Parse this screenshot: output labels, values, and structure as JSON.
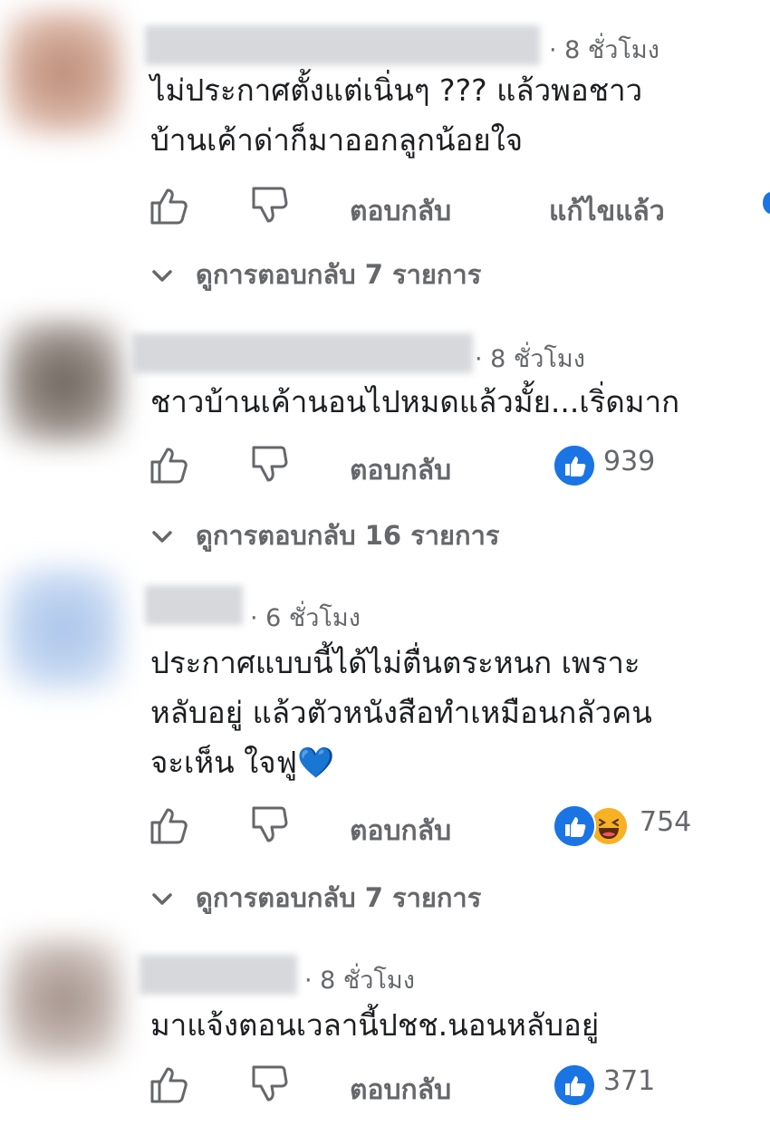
{
  "colors": {
    "accent": "#1b74e4",
    "secondary_text": "#65676b",
    "primary_text": "#1c1e21",
    "haha": "#f7b125"
  },
  "icons": {
    "like": "thumbs-up-outline-icon",
    "dislike": "thumbs-down-outline-icon",
    "expand": "chevron-down-icon",
    "reaction_like": "like-reaction-icon",
    "reaction_haha": "haha-reaction-icon"
  },
  "comments": [
    {
      "time": "· 8 ชั่วโมง",
      "text": "ไม่ประกาศตั้งแต่เนิ่นๆ ??? แล้วพอชาว\nบ้านเค้าด่าก็มาออกลูกน้อยใจ",
      "reply_label": "ตอบกลับ",
      "edited_label": "แก้ไขแล้ว",
      "view_replies": "ดูการตอบกลับ 7 รายการ"
    },
    {
      "time": "· 8 ชั่วโมง",
      "text": "ชาวบ้านเค้านอนไปหมดแล้วมั้ย...เริ่ดมาก",
      "reply_label": "ตอบกลับ",
      "reaction_count": "939",
      "view_replies": "ดูการตอบกลับ 16 รายการ"
    },
    {
      "time": "· 6 ชั่วโมง",
      "text": "ประกาศแบบนี้ได้ไม่ตื่นตระหนก เพราะ\nหลับอยู่ แล้วตัวหนังสือทำเหมือนกลัวคน\nจะเห็น ใจฟู💙",
      "reply_label": "ตอบกลับ",
      "reaction_count": "754",
      "view_replies": "ดูการตอบกลับ 7 รายการ"
    },
    {
      "time": "· 8 ชั่วโมง",
      "text": "มาแจ้งตอนเวลานี้ปชช.นอนหลับอยู่",
      "reply_label": "ตอบกลับ",
      "reaction_count": "371"
    }
  ]
}
